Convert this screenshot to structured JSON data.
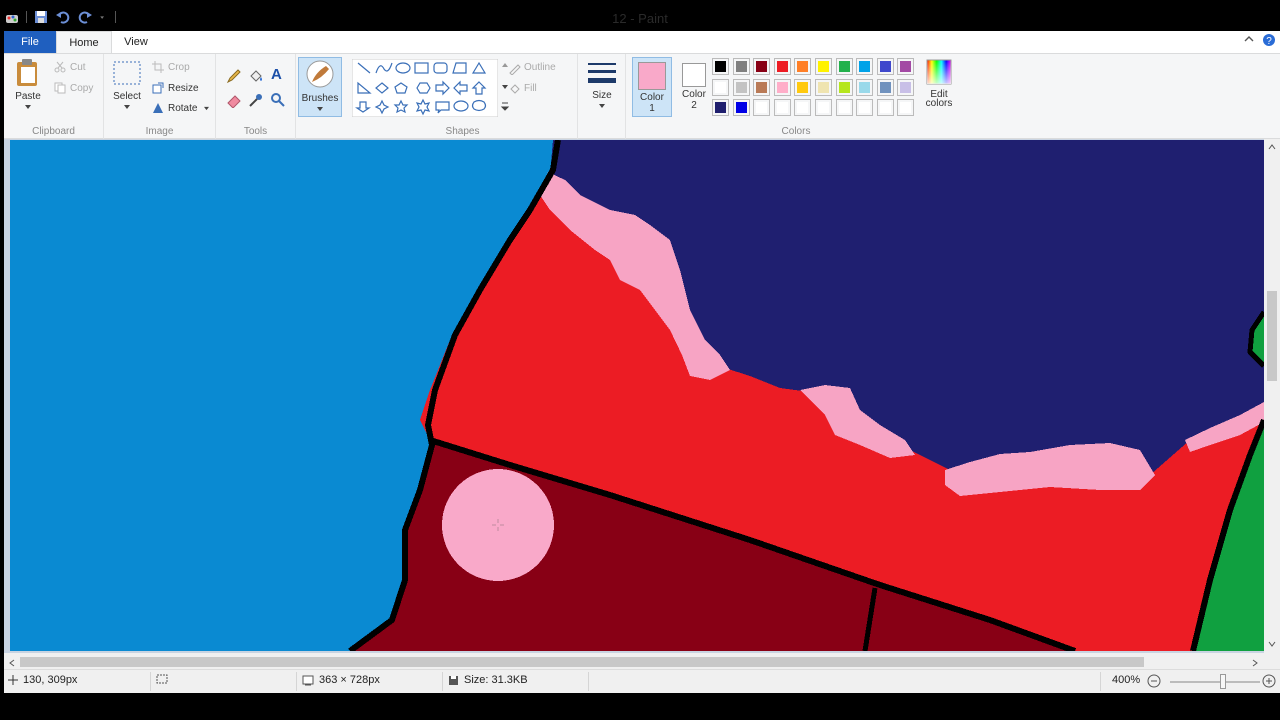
{
  "window": {
    "title": "12 - Paint"
  },
  "tabs": {
    "file": "File",
    "home": "Home",
    "view": "View"
  },
  "clipboard": {
    "paste": "Paste",
    "cut": "Cut",
    "copy": "Copy",
    "group": "Clipboard"
  },
  "image": {
    "select": "Select",
    "crop": "Crop",
    "resize": "Resize",
    "rotate": "Rotate",
    "group": "Image"
  },
  "tools": {
    "group": "Tools",
    "text_tool": "A"
  },
  "brushes": {
    "label": "Brushes"
  },
  "shapes": {
    "outline": "Outline",
    "fill": "Fill",
    "group": "Shapes"
  },
  "size": {
    "label": "Size"
  },
  "colors": {
    "color1_label": "Color 1",
    "color1_line1": "Color",
    "color1_line2": "1",
    "color2_line1": "Color",
    "color2_line2": "2",
    "group": "Colors",
    "edit_line1": "Edit",
    "edit_line2": "colors",
    "color1_value": "#f9a9c9",
    "color2_value": "#ffffff",
    "palette_row1": [
      "#000000",
      "#7f7f7f",
      "#880015",
      "#ed1c24",
      "#ff7f27",
      "#fff200",
      "#22b14c",
      "#00a2e8",
      "#3f48cc",
      "#a349a4"
    ],
    "palette_row2": [
      "#ffffff",
      "#c3c3c3",
      "#b97a57",
      "#ffaec9",
      "#ffc90e",
      "#efe4b0",
      "#b5e61d",
      "#99d9ea",
      "#7092be",
      "#c8bfe7"
    ],
    "palette_row3": [
      "#1f1f6e",
      "#0000e6",
      "#ffffff",
      "#ffffff",
      "#ffffff",
      "#ffffff",
      "#ffffff",
      "#ffffff",
      "#ffffff",
      "#ffffff"
    ]
  },
  "canvas_colors": {
    "sky": "#0a8ad2",
    "navy": "#1f1f70",
    "red": "#ec1c24",
    "pink": "#f7a4c4",
    "darkred": "#880015",
    "green": "#10a040",
    "outline": "#000000"
  },
  "status": {
    "cursor": "130, 309px",
    "dimensions": "363 × 728px",
    "size": "Size: 31.3KB",
    "zoom": "400%"
  }
}
